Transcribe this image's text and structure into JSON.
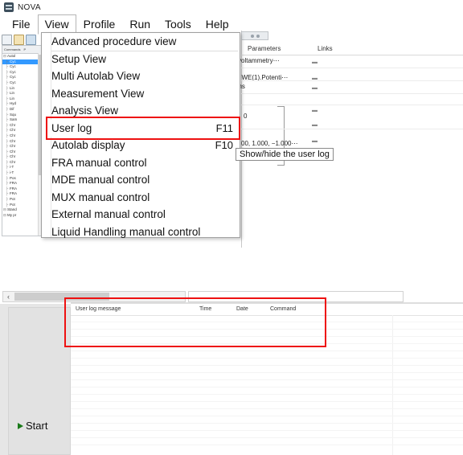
{
  "window": {
    "title": "NOVA",
    "icon": "nova-app-icon"
  },
  "menubar": {
    "items": [
      {
        "label": "File",
        "active": false
      },
      {
        "label": "View",
        "active": true
      },
      {
        "label": "Profile",
        "active": false
      },
      {
        "label": "Run",
        "active": false
      },
      {
        "label": "Tools",
        "active": false
      },
      {
        "label": "Help",
        "active": false
      }
    ]
  },
  "view_menu": {
    "items": [
      {
        "label": "Advanced procedure view",
        "shortcut": "",
        "highlighted": false
      },
      {
        "label": "Setup View",
        "shortcut": "",
        "highlighted": false
      },
      {
        "label": "Multi Autolab View",
        "shortcut": "",
        "highlighted": false
      },
      {
        "label": "Measurement View",
        "shortcut": "",
        "highlighted": false
      },
      {
        "label": "Analysis View",
        "shortcut": "",
        "highlighted": false
      },
      {
        "label": "User log",
        "shortcut": "F11",
        "highlighted": true
      },
      {
        "label": "Autolab display",
        "shortcut": "F10",
        "highlighted": false
      },
      {
        "label": "FRA manual control",
        "shortcut": "",
        "highlighted": false
      },
      {
        "label": "MDE manual control",
        "shortcut": "",
        "highlighted": false
      },
      {
        "label": "MUX manual control",
        "shortcut": "",
        "highlighted": false
      },
      {
        "label": "External manual control",
        "shortcut": "",
        "highlighted": false
      },
      {
        "label": "Liquid Handling manual control",
        "shortcut": "",
        "highlighted": false
      }
    ]
  },
  "tooltip": {
    "text": "Show/hide the user log"
  },
  "commands_tree": {
    "tabs": [
      "Commands",
      "P"
    ],
    "rows": [
      {
        "label": "Autol",
        "selected": false,
        "root": true
      },
      {
        "label": "Cyc",
        "selected": true,
        "root": false
      },
      {
        "label": "Cyc",
        "selected": false,
        "root": false
      },
      {
        "label": "Cyc",
        "selected": false,
        "root": false
      },
      {
        "label": "Cyc",
        "selected": false,
        "root": false
      },
      {
        "label": "Cyc",
        "selected": false,
        "root": false
      },
      {
        "label": "Lin",
        "selected": false,
        "root": false
      },
      {
        "label": "Lin",
        "selected": false,
        "root": false
      },
      {
        "label": "Lin",
        "selected": false,
        "root": false
      },
      {
        "label": "Hyd",
        "selected": false,
        "root": false
      },
      {
        "label": "Dif",
        "selected": false,
        "root": false
      },
      {
        "label": "Squ",
        "selected": false,
        "root": false
      },
      {
        "label": "Sam",
        "selected": false,
        "root": false
      },
      {
        "label": "Chr",
        "selected": false,
        "root": false
      },
      {
        "label": "Chr",
        "selected": false,
        "root": false
      },
      {
        "label": "Chr",
        "selected": false,
        "root": false
      },
      {
        "label": "Chr",
        "selected": false,
        "root": false
      },
      {
        "label": "Chr",
        "selected": false,
        "root": false
      },
      {
        "label": "Chr",
        "selected": false,
        "root": false
      },
      {
        "label": "Chr",
        "selected": false,
        "root": false
      },
      {
        "label": "Chr",
        "selected": false,
        "root": false
      },
      {
        "label": "i-T",
        "selected": false,
        "root": false
      },
      {
        "label": "i-T",
        "selected": false,
        "root": false
      },
      {
        "label": "Pos",
        "selected": false,
        "root": false
      },
      {
        "label": "FRA",
        "selected": false,
        "root": false
      },
      {
        "label": "FRA",
        "selected": false,
        "root": false
      },
      {
        "label": "FRA",
        "selected": false,
        "root": false
      },
      {
        "label": "Pot",
        "selected": false,
        "root": false
      },
      {
        "label": "Pot",
        "selected": false,
        "root": false
      },
      {
        "label": "Stand",
        "selected": false,
        "root": true
      },
      {
        "label": "My pr",
        "selected": false,
        "root": true
      }
    ]
  },
  "procedure_doc": {
    "columns": [
      "Parameters",
      "Links"
    ],
    "lines": [
      "ic voltammetry⋯",
      ", WE(1).Potenti⋯",
      "tions",
      "0",
      "00,  1.000,  −1.000⋯"
    ]
  },
  "user_log": {
    "columns": [
      "User log message",
      "Time",
      "Date",
      "Command"
    ],
    "rows": []
  },
  "run_panel": {
    "start_label": "Start"
  },
  "scrollbar": {
    "left_arrow": "‹"
  },
  "colors": {
    "annotation_red": "#ee1111",
    "selection_blue": "#3399ff",
    "start_green": "#1a7a1a",
    "panel_gray": "#e6e6e6"
  }
}
